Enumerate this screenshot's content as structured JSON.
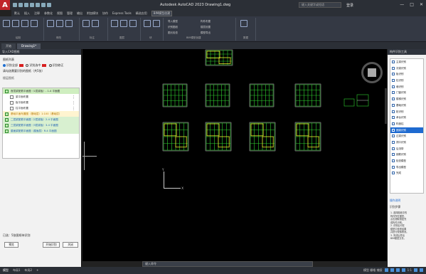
{
  "titlebar": {
    "title": "Autodesk AutoCAD 2023  Drawing1.dwg",
    "search_placeholder": "键入关键字或短语",
    "user": "登录",
    "min": "—",
    "max": "□",
    "close": "✕"
  },
  "menu": [
    "默认",
    "插入",
    "注释",
    "参数化",
    "视图",
    "管理",
    "输出",
    "附加模块",
    "协作",
    "Express Tools",
    "精选应用",
    "BIM模型创建"
  ],
  "menu_active_index": 11,
  "ribbon": {
    "groups": [
      "绘制",
      "修改",
      "标注",
      "图层",
      "块",
      "数据",
      "BIM模型创建"
    ],
    "text_buttons": [
      "导入模型",
      "识别图纸",
      "图元检查",
      "构件布置",
      "楼层设置",
      "模型导出"
    ]
  },
  "doctabs": [
    "开始",
    "Drawing1*"
  ],
  "left_panel": {
    "title": "导入CAD图纸",
    "section": "图纸列表",
    "radio_all": "识别全部",
    "radio_selected": "识别选中",
    "radio_fix": "识别修正",
    "hint": "请勾选需要识别的图纸（共5张）",
    "tree_header": "楼层图纸",
    "items": [
      {
        "label": "首层梁配筋平面图（1层梁板）- 1-4 平面图",
        "style": "hl"
      },
      {
        "label": "梁平面布置",
        "style": "sub"
      },
      {
        "label": "板平面布置",
        "style": "sub"
      },
      {
        "label": "柱平面布置",
        "style": "sub"
      },
      {
        "label": "基础平面布置图（基础层）1:100（基础层）",
        "style": "orange"
      },
      {
        "label": "二层梁配筋平面图（2层梁板）2-4 平面图",
        "style": "blue"
      },
      {
        "label": "三层梁配筋平面图（3层梁板）3-4 平面图",
        "style": "blue"
      },
      {
        "label": "屋面梁配筋平面图（屋面层）R-4 平面图",
        "style": "blue"
      }
    ],
    "bottom_label": "已选：5张图纸待识别",
    "btn_preview": "预览",
    "btn_identify": "开始识别",
    "btn_close": "关闭"
  },
  "canvas": {
    "ucs_x": "X",
    "ucs_y": "Y",
    "command_prompt": "键入命令"
  },
  "right_panel": {
    "title": "构件识别工具",
    "items": [
      "主梁识别",
      "次梁识别",
      "板识别",
      "柱识别",
      "墙识别",
      "门窗识别",
      "楼梯识别",
      "基础识别",
      "桩识别",
      "承台识别",
      "构造柱",
      "圈梁识别",
      "过梁识别",
      "洞口识别",
      "后浇带",
      "钢筋识别",
      "检查模型",
      "导出模型",
      "完成"
    ],
    "selected_index": 11,
    "info_title": "操作说明",
    "info_sub": "识别步骤",
    "info_lines": [
      "1. 选择图纸中的",
      "构件所在图层，",
      "点击提取按钮完",
      "成构件识别。",
      "2. 识别后可在",
      "模型中查看结果",
      "并进行校核修改。",
      "3. 完成后导出",
      "BIM模型文件。"
    ]
  },
  "statusbar": {
    "tabs": [
      "模型",
      "布局1",
      "布局2",
      "+"
    ],
    "active_tab": 0,
    "coords": "模型 栅格 捕捉",
    "scale": "1:1"
  },
  "colors": {
    "accent": "#1e6ad0",
    "drawing_green": "#2fd12f",
    "drawing_yellow": "#e8e02a",
    "canvas_bg": "#000000"
  }
}
